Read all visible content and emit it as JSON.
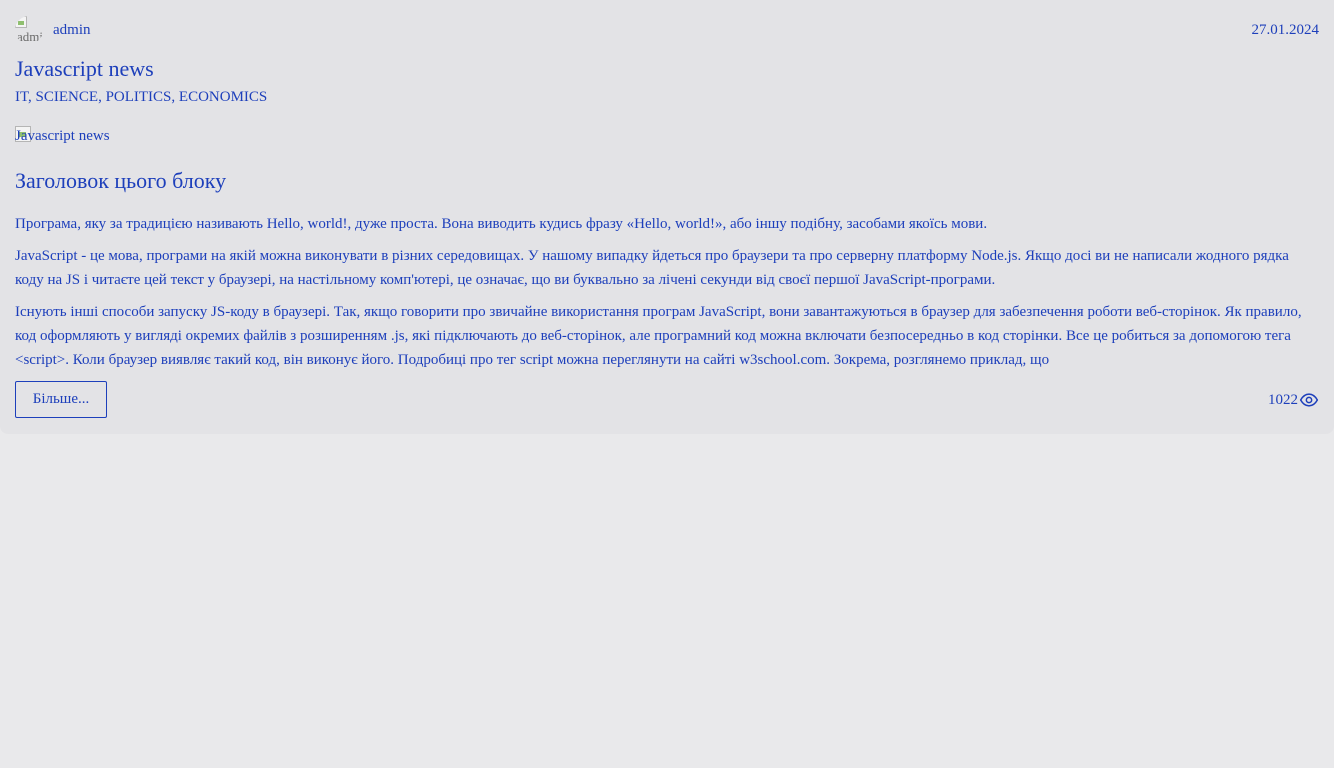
{
  "post": {
    "author_avatar_alt": "admin",
    "author": "admin",
    "date": "27.01.2024",
    "title": "Javascript news",
    "categories": [
      "IT",
      "SCIENCE",
      "POLITICS",
      "ECONOMICS"
    ],
    "cover_alt": "Javascript news",
    "block_heading": "Заголовок цього блоку",
    "paragraphs": [
      "Програма, яку за традицією називають Hello, world!, дуже проста. Вона виводить кудись фразу «Hello, world!», або іншу подібну, засобами якоїсь мови.",
      "JavaScript - це мова, програми на якій можна виконувати в різних середовищах. У нашому випадку йдеться про браузери та про серверну платформу Node.js. Якщо досі ви не написали жодного рядка коду на JS і читаєте цей текст у браузері, на настільному комп'ютері, це означає, що ви буквально за лічені секунди від своєї першої JavaScript-програми.",
      "Існують інші способи запуску JS-коду в браузері. Так, якщо говорити про звичайне використання програм JavaScript, вони завантажуються в браузер для забезпечення роботи веб-сторінок. Як правило, код оформляють у вигляді окремих файлів з розширенням .js, які підключають до веб-сторінок, але програмний код можна включати безпосередньо в код сторінки. Все це робиться за допомогою тега <script>. Коли браузер виявляє такий код, він виконує його. Подробиці про тег script можна переглянути на сайті w3school.com. Зокрема, розглянемо приклад, що"
    ],
    "more_label": "Більше...",
    "views": "1022"
  },
  "icons": {
    "views": "eye-icon"
  },
  "colors": {
    "text": "#1d3fbb",
    "card_background": "#e3e3e6",
    "page_background": "#e9e9eb"
  }
}
